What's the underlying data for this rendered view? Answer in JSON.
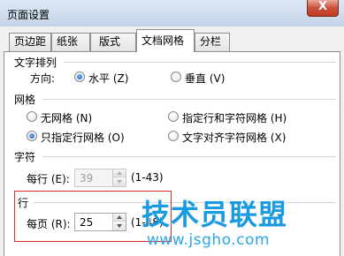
{
  "window": {
    "title": "页面设置",
    "close_label": "X"
  },
  "tabs": [
    {
      "label": "页边距"
    },
    {
      "label": "纸张"
    },
    {
      "label": "版式"
    },
    {
      "label": "文档网格"
    },
    {
      "label": "分栏"
    }
  ],
  "text_direction": {
    "heading": "文字排列",
    "direction_label": "方向:",
    "horizontal_label": "水平 (Z)",
    "vertical_label": "垂直 (V)",
    "selected": "horizontal"
  },
  "grid": {
    "heading": "网格",
    "options": [
      {
        "label": "无网格 (N)",
        "selected": false
      },
      {
        "label": "指定行和字符网格 (H)",
        "selected": false
      },
      {
        "label": "只指定行网格 (O)",
        "selected": true
      },
      {
        "label": "文字对齐字符网格 (X)",
        "selected": false
      }
    ]
  },
  "characters": {
    "heading": "字符",
    "per_line_label": "每行 (E):",
    "per_line_value": "39",
    "per_line_range": "(1-43)"
  },
  "lines": {
    "heading": "行",
    "per_page_label": "每页 (R):",
    "per_page_value": "25",
    "per_page_range": "(1-48)"
  },
  "watermark": {
    "text": "技术员联盟",
    "url": "www.jsgho.com"
  },
  "colors": {
    "highlight": "#d72c2c",
    "radio_on": "#1460c2",
    "watermark": "#1a9ae0"
  }
}
